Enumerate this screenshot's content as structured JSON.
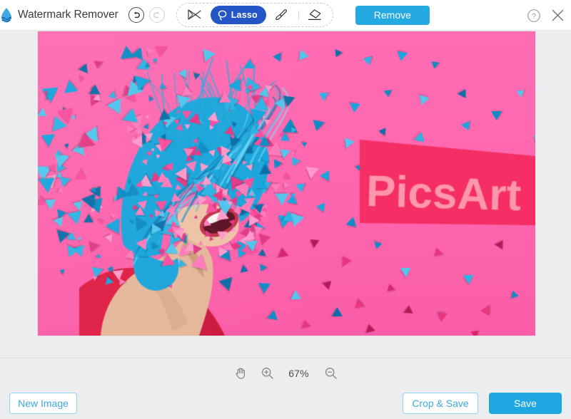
{
  "app": {
    "title": "Watermark Remover",
    "logo_icon": "water-drop-logo"
  },
  "header": {
    "undo_icon": "undo-arrow-icon",
    "redo_icon": "redo-arrow-icon",
    "tools": [
      {
        "id": "magic-wand",
        "icon": "magic-wand-icon",
        "label": "",
        "active": false
      },
      {
        "id": "lasso",
        "icon": "lasso-icon",
        "label": "Lasso",
        "active": true
      },
      {
        "id": "brush",
        "icon": "brush-icon",
        "label": "",
        "active": false
      },
      {
        "id": "eraser",
        "icon": "eraser-icon",
        "label": "",
        "active": false
      }
    ],
    "remove_label": "Remove",
    "help_icon": "help-circle-icon",
    "close_icon": "close-x-icon"
  },
  "zoombar": {
    "pan_icon": "hand-pan-icon",
    "zoom_in_icon": "zoom-in-icon",
    "zoom_out_icon": "zoom-out-icon",
    "zoom_level": "67%"
  },
  "footer": {
    "new_image_label": "New Image",
    "crop_save_label": "Crop & Save",
    "save_label": "Save"
  },
  "image": {
    "watermark_text": "PicsArt",
    "alt": "Woman with blue hair dispersing into triangles on pink background wearing red dress",
    "selection_shape": "lasso-quadrilateral"
  },
  "colors": {
    "accent_blue": "#1EA7E1",
    "tool_active_blue": "#2456C6",
    "outline_blue": "#8FD3F0",
    "canvas_bg": "#ECEDEF",
    "header_bg": "#FFFFFF",
    "photo_pink": "#FF63AE",
    "selection_pink": "#F52F66",
    "dress_red": "#E01F45",
    "hair_blue": "#1BA6DB"
  }
}
